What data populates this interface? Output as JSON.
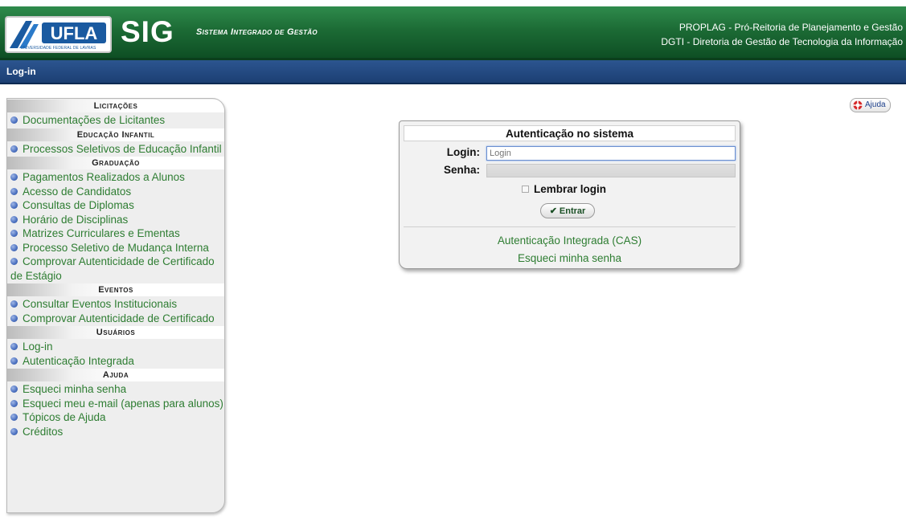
{
  "header": {
    "logo_text": "UFLA",
    "logo_caption": "UNIVERSIDADE FEDERAL DE LAVRAS",
    "title": "SIG",
    "subtitle": "Sistema Integrado de Gestão",
    "right_line1": "PROPLAG - Pró-Reitoria de Planejamento e Gestão",
    "right_line2": "DGTI - Diretoria de Gestão de Tecnologia da Informação"
  },
  "nav": {
    "current": "Log-in"
  },
  "colors": {
    "header_green": "#1c6b35",
    "nav_blue": "#1c3f73",
    "link_green": "#2e7d32",
    "bullet_blue": "#4a6fbf"
  },
  "sidebar": {
    "sections": [
      {
        "heading": "Licitações",
        "items": [
          "Documentações de Licitantes"
        ]
      },
      {
        "heading": "Educação Infantil",
        "items": [
          "Processos Seletivos de Educação Infantil"
        ]
      },
      {
        "heading": "Graduação",
        "items": [
          "Pagamentos Realizados a Alunos",
          "Acesso de Candidatos",
          "Consultas de Diplomas",
          "Horário de Disciplinas",
          "Matrizes Curriculares e Ementas",
          "Processo Seletivo de Mudança Interna",
          "Comprovar Autenticidade de Certificado de Estágio"
        ]
      },
      {
        "heading": "Eventos",
        "items": [
          "Consultar Eventos Institucionais",
          "Comprovar Autenticidade de Certificado"
        ]
      },
      {
        "heading": "Usuários",
        "items": [
          "Log-in",
          "Autenticação Integrada"
        ]
      },
      {
        "heading": "Ajuda",
        "items": [
          "Esqueci minha senha",
          "Esqueci meu e-mail (apenas para alunos)",
          "Tópicos de Ajuda",
          "Créditos"
        ]
      }
    ]
  },
  "help": {
    "label": "Ajuda",
    "icon": "lifebuoy-icon"
  },
  "login": {
    "title": "Autenticação no sistema",
    "login_label": "Login:",
    "login_placeholder": "Login",
    "login_value": "",
    "password_label": "Senha:",
    "remember_label": "Lembrar login",
    "remember_checked": false,
    "submit_label": "Entrar",
    "cas_link": "Autenticação Integrada (CAS)",
    "forgot_link": "Esqueci minha senha"
  }
}
